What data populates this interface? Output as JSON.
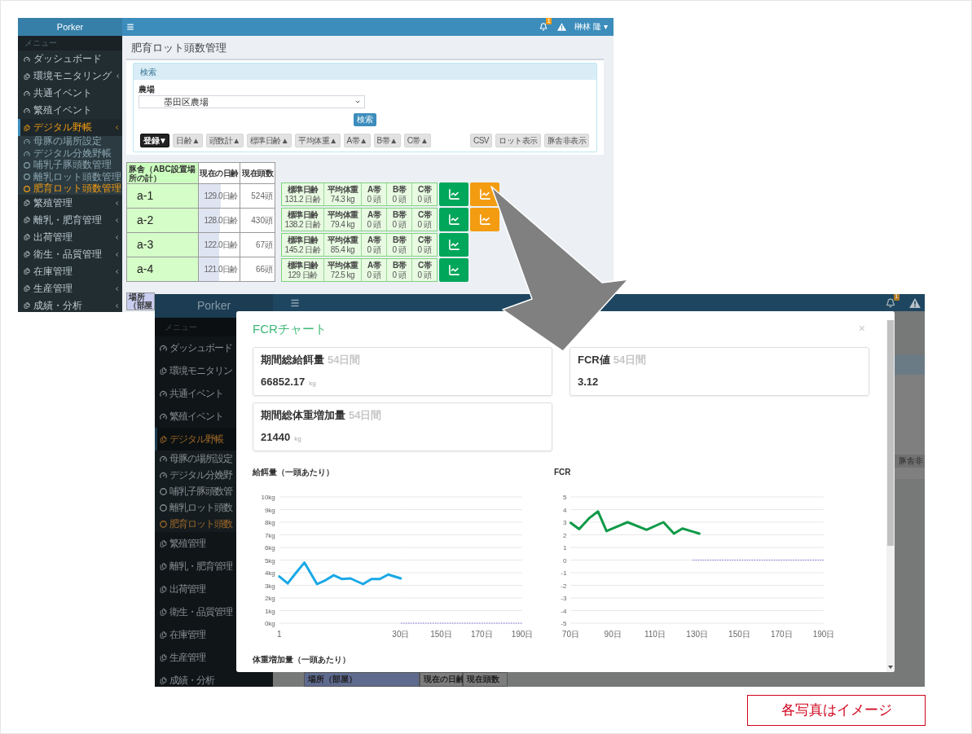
{
  "back_screen": {
    "header": {
      "logo": "Porker",
      "badge": "1",
      "user": "榊林 隆 ▾"
    },
    "sidebar": {
      "heading": "メニュー",
      "items": [
        {
          "label": "ダッシュボード",
          "kind": "page",
          "selected": false
        },
        {
          "label": "環境モニタリング",
          "kind": "group",
          "selected": false
        },
        {
          "label": "共通イベント",
          "kind": "page",
          "selected": false
        },
        {
          "label": "繁殖イベント",
          "kind": "page",
          "selected": false
        },
        {
          "label": "デジタル野帳",
          "kind": "group",
          "selected": true,
          "children": [
            {
              "label": "母豚の場所設定",
              "kind": "page",
              "selected": false
            },
            {
              "label": "デジタル分娩野帳",
              "kind": "page",
              "selected": false
            },
            {
              "label": "哺乳子豚頭数管理",
              "kind": "entry",
              "selected": false
            },
            {
              "label": "離乳ロット頭数管理",
              "kind": "entry",
              "selected": false
            },
            {
              "label": "肥育ロット頭数管理",
              "kind": "entry",
              "selected": true
            }
          ]
        },
        {
          "label": "繁殖管理",
          "kind": "group",
          "selected": false
        },
        {
          "label": "離乳・肥育管理",
          "kind": "group",
          "selected": false
        },
        {
          "label": "出荷管理",
          "kind": "group",
          "selected": false
        },
        {
          "label": "衛生・品質管理",
          "kind": "group",
          "selected": false
        },
        {
          "label": "在庫管理",
          "kind": "group",
          "selected": false
        },
        {
          "label": "生産管理",
          "kind": "group",
          "selected": false
        },
        {
          "label": "成績・分析",
          "kind": "group",
          "selected": false
        }
      ]
    },
    "page_title": "肥育ロット頭数管理",
    "search_panel": {
      "title": "検索",
      "farm_label": "農場",
      "farm_value": "墨田区農場",
      "search_button": "検索"
    },
    "toolbar": {
      "left": [
        {
          "label": "登録▼",
          "kind": "dark"
        },
        {
          "label": "日齢▲",
          "kind": "light"
        },
        {
          "label": "頭数計▲",
          "kind": "light"
        },
        {
          "label": "標準日齢▲",
          "kind": "light"
        },
        {
          "label": "平均体重▲",
          "kind": "light"
        },
        {
          "label": "A帯▲",
          "kind": "light"
        },
        {
          "label": "B帯▲",
          "kind": "light"
        },
        {
          "label": "C帯▲",
          "kind": "light"
        }
      ],
      "right": [
        {
          "label": "CSV",
          "kind": "light"
        },
        {
          "label": "ロット表示",
          "kind": "light"
        },
        {
          "label": "豚舎非表示",
          "kind": "light"
        }
      ]
    },
    "barn_table": {
      "columns": [
        "豚舎（ABC設置場所の計）",
        "現在の日齢",
        "現在頭数"
      ],
      "rows": [
        {
          "barn": "a-1",
          "age": "129.0日齢",
          "level": 0.54,
          "count": "524頭"
        },
        {
          "barn": "a-2",
          "age": "128.0日齢",
          "level": 0.52,
          "count": "430頭"
        },
        {
          "barn": "a-3",
          "age": "122.0日齢",
          "level": 0.5,
          "count": "67頭"
        },
        {
          "barn": "a-4",
          "age": "121.0日齢",
          "level": 0.49,
          "count": "66頭"
        }
      ]
    },
    "lot_rows": [
      {
        "cells": [
          {
            "label": "標準日齢",
            "value": "131.2 日齢"
          },
          {
            "label": "平均体重",
            "value": "74.3 kg"
          },
          {
            "label": "A帯",
            "value": "0 頭"
          },
          {
            "label": "B帯",
            "value": "0 頭"
          },
          {
            "label": "C帯",
            "value": "0 頭"
          }
        ],
        "chart_buttons": [
          {
            "color": "#00a65a"
          },
          {
            "color": "#f39c12"
          }
        ]
      },
      {
        "cells": [
          {
            "label": "標準日齢",
            "value": "138.2 日齢"
          },
          {
            "label": "平均体重",
            "value": "79.4 kg"
          },
          {
            "label": "A帯",
            "value": "0 頭"
          },
          {
            "label": "B帯",
            "value": "0 頭"
          },
          {
            "label": "C帯",
            "value": "0 頭"
          }
        ],
        "chart_buttons": [
          {
            "color": "#00a65a"
          },
          {
            "color": "#f39c12"
          }
        ]
      },
      {
        "cells": [
          {
            "label": "標準日齢",
            "value": "145.2 日齢"
          },
          {
            "label": "平均体重",
            "value": "85.4 kg"
          },
          {
            "label": "A帯",
            "value": "0 頭"
          },
          {
            "label": "B帯",
            "value": "0 頭"
          },
          {
            "label": "C帯",
            "value": "0 頭"
          }
        ],
        "chart_buttons": [
          {
            "color": "#00a65a"
          }
        ]
      },
      {
        "cells": [
          {
            "label": "標準日齢",
            "value": "129 日齢"
          },
          {
            "label": "平均体重",
            "value": "72.5 kg"
          },
          {
            "label": "A帯",
            "value": "0 頭"
          },
          {
            "label": "B帯",
            "value": "0 頭"
          },
          {
            "label": "C帯",
            "value": "0 頭"
          }
        ],
        "chart_buttons": [
          {
            "color": "#00a65a"
          }
        ]
      }
    ],
    "location_table": {
      "columns": [
        "場所（部屋"
      ]
    }
  },
  "front_screen": {
    "header": {
      "logo": "Porker",
      "badge": "1"
    },
    "sidebar": {
      "heading": "メニュー",
      "items": [
        {
          "label": "ダッシュボード",
          "kind": "page",
          "selected": false
        },
        {
          "label": "環境モニタリン",
          "kind": "group",
          "selected": false
        },
        {
          "label": "共通イベント",
          "kind": "page",
          "selected": false
        },
        {
          "label": "繁殖イベント",
          "kind": "page",
          "selected": false
        },
        {
          "label": "デジタル野帳",
          "kind": "group",
          "selected": true,
          "children": [
            {
              "label": "母豚の場所設定",
              "kind": "page",
              "selected": false
            },
            {
              "label": "デジタル分娩野",
              "kind": "page",
              "selected": false
            },
            {
              "label": "哺乳子豚頭数管",
              "kind": "entry",
              "selected": false
            },
            {
              "label": "離乳ロット頭数",
              "kind": "entry",
              "selected": false
            },
            {
              "label": "肥育ロット頭数",
              "kind": "entry",
              "selected": true
            }
          ]
        },
        {
          "label": "繁殖管理",
          "kind": "group",
          "selected": false
        },
        {
          "label": "離乳・肥育管理",
          "kind": "group",
          "selected": false
        },
        {
          "label": "出荷管理",
          "kind": "group",
          "selected": false
        },
        {
          "label": "衛生・品質管理",
          "kind": "group",
          "selected": false
        },
        {
          "label": "在庫管理",
          "kind": "group",
          "selected": false
        },
        {
          "label": "生産管理",
          "kind": "group",
          "selected": false
        },
        {
          "label": "成績・分析",
          "kind": "group",
          "selected": false
        }
      ]
    },
    "background": {
      "panel_button": "豚舎非",
      "table_columns": [
        "場所（部屋）",
        "現在の日齢",
        "現在頭数"
      ]
    },
    "modal": {
      "title": "FCRチャート",
      "close": "×",
      "stats": [
        {
          "title": "期間総給餌量",
          "period": "54日間",
          "value": "66852.17",
          "unit": "kg"
        },
        {
          "title": "FCR値",
          "period": "54日間",
          "value": "3.12"
        },
        {
          "title": "期間総体重増加量",
          "period": "54日間",
          "value": "21440",
          "unit": "kg"
        }
      ],
      "charts": [
        {
          "layers": [
            {
              "chart_data": {
                "type": "line",
                "title": "給餌量（一頭あたり）",
                "grid": true,
                "x": [
                  1,
                  3,
                  5,
                  7,
                  10,
                  12,
                  14,
                  16,
                  18,
                  21,
                  23,
                  25,
                  27,
                  30
                ],
                "series": [
                  {
                    "color": "#1aa8e6",
                    "line_style": "solid",
                    "values": [
                      3.7,
                      3.15,
                      4.0,
                      4.8,
                      3.1,
                      3.4,
                      3.8,
                      3.5,
                      3.55,
                      3.1,
                      3.5,
                      3.5,
                      3.85,
                      3.55
                    ]
                  }
                ],
                "xlim": [
                  1,
                  30
                ],
                "ylim": [
                  0,
                  10
                ],
                "xticks": [
                  {
                    "value": 1,
                    "label": "1"
                  },
                  {
                    "value": 30,
                    "label": "30日"
                  }
                ],
                "yticks": [
                  {
                    "value": 0,
                    "label": "0kg"
                  },
                  {
                    "value": 1,
                    "label": "1kg"
                  },
                  {
                    "value": 2,
                    "label": "2kg"
                  },
                  {
                    "value": 3,
                    "label": "3kg"
                  },
                  {
                    "value": 4,
                    "label": "4kg"
                  },
                  {
                    "value": 5,
                    "label": "5kg"
                  },
                  {
                    "value": 6,
                    "label": "6kg"
                  },
                  {
                    "value": 7,
                    "label": "7kg"
                  },
                  {
                    "value": 8,
                    "label": "8kg"
                  },
                  {
                    "value": 9,
                    "label": "9kg"
                  },
                  {
                    "value": 10,
                    "label": "10kg"
                  }
                ]
              }
            },
            {
              "chart_data": {
                "type": "line",
                "grid": true,
                "x": [
                  130,
                  190
                ],
                "series": [
                  {
                    "color": "#7b6fd6",
                    "line_style": "dotted",
                    "values": [
                      0,
                      0
                    ]
                  }
                ],
                "xlim": [
                  130,
                  190
                ],
                "ylim": [
                  0,
                  10
                ],
                "xticks": [
                  {
                    "value": 150,
                    "label": "150日"
                  },
                  {
                    "value": 170,
                    "label": "170日"
                  },
                  {
                    "value": 190,
                    "label": "190日"
                  }
                ]
              }
            }
          ]
        },
        {
          "layers": [
            {
              "chart_data": {
                "type": "line",
                "title": "FCR",
                "grid": true,
                "x": [
                  70,
                  74,
                  79,
                  83,
                  87,
                  97,
                  106,
                  114,
                  119,
                  123,
                  128,
                  131,
                  190
                ],
                "series": [
                  {
                    "color": "#0f9a48",
                    "line_style": "solid",
                    "values": [
                      2.95,
                      2.45,
                      3.35,
                      3.85,
                      2.3,
                      3.0,
                      2.4,
                      3.0,
                      2.1,
                      2.5,
                      2.25,
                      2.1,
                      null
                    ]
                  },
                  {
                    "color": "#7b6fd6",
                    "line_style": "dotted",
                    "values": [
                      null,
                      null,
                      null,
                      null,
                      null,
                      null,
                      null,
                      null,
                      null,
                      null,
                      0,
                      0,
                      0
                    ]
                  }
                ],
                "xlim": [
                  70,
                  190
                ],
                "ylim": [
                  -5,
                  5
                ],
                "xticks": [
                  {
                    "value": 70,
                    "label": "70日"
                  },
                  {
                    "value": 90,
                    "label": "90日"
                  },
                  {
                    "value": 110,
                    "label": "110日"
                  },
                  {
                    "value": 130,
                    "label": "130日"
                  },
                  {
                    "value": 150,
                    "label": "150日"
                  },
                  {
                    "value": 170,
                    "label": "170日"
                  },
                  {
                    "value": 190,
                    "label": "190日"
                  }
                ],
                "yticks": [
                  -5,
                  -4,
                  -3,
                  -2,
                  -1,
                  0,
                  1,
                  2,
                  3,
                  4,
                  5
                ]
              }
            }
          ]
        }
      ],
      "next_title": "体重増加量（一頭あたり）"
    }
  },
  "caption": "各写真はイメージ"
}
